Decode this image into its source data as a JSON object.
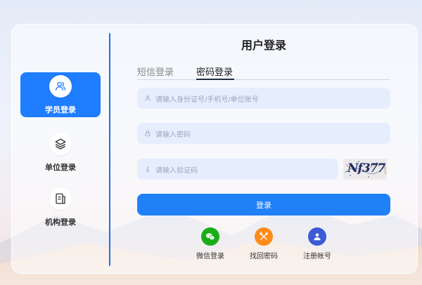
{
  "page_title": "用户登录",
  "sidebar": {
    "items": [
      {
        "label": "学员登录",
        "icon": "users-icon",
        "active": true
      },
      {
        "label": "单位登录",
        "icon": "layers-icon",
        "active": false
      },
      {
        "label": "机构登录",
        "icon": "document-icon",
        "active": false
      }
    ]
  },
  "tabs": [
    {
      "label": "短信登录",
      "active": false
    },
    {
      "label": "密码登录",
      "active": true
    }
  ],
  "form": {
    "account_placeholder": "请输入身份证号/手机号/单位账号",
    "password_placeholder": "请输入密码",
    "captcha_placeholder": "请输入验证码",
    "captcha_text": "Nf377",
    "login_label": "登录"
  },
  "actions": [
    {
      "label": "微信登录",
      "icon": "wechat-icon",
      "color": "#1aad19"
    },
    {
      "label": "找回密码",
      "icon": "tools-icon",
      "color": "#ff8c1a"
    },
    {
      "label": "注册帐号",
      "icon": "user-add-icon",
      "color": "#3b5bd6"
    }
  ],
  "colors": {
    "primary": "#1f7dff",
    "button": "#2080f8",
    "input_bg": "#e6eefe",
    "divider": "#1f6fe8"
  }
}
